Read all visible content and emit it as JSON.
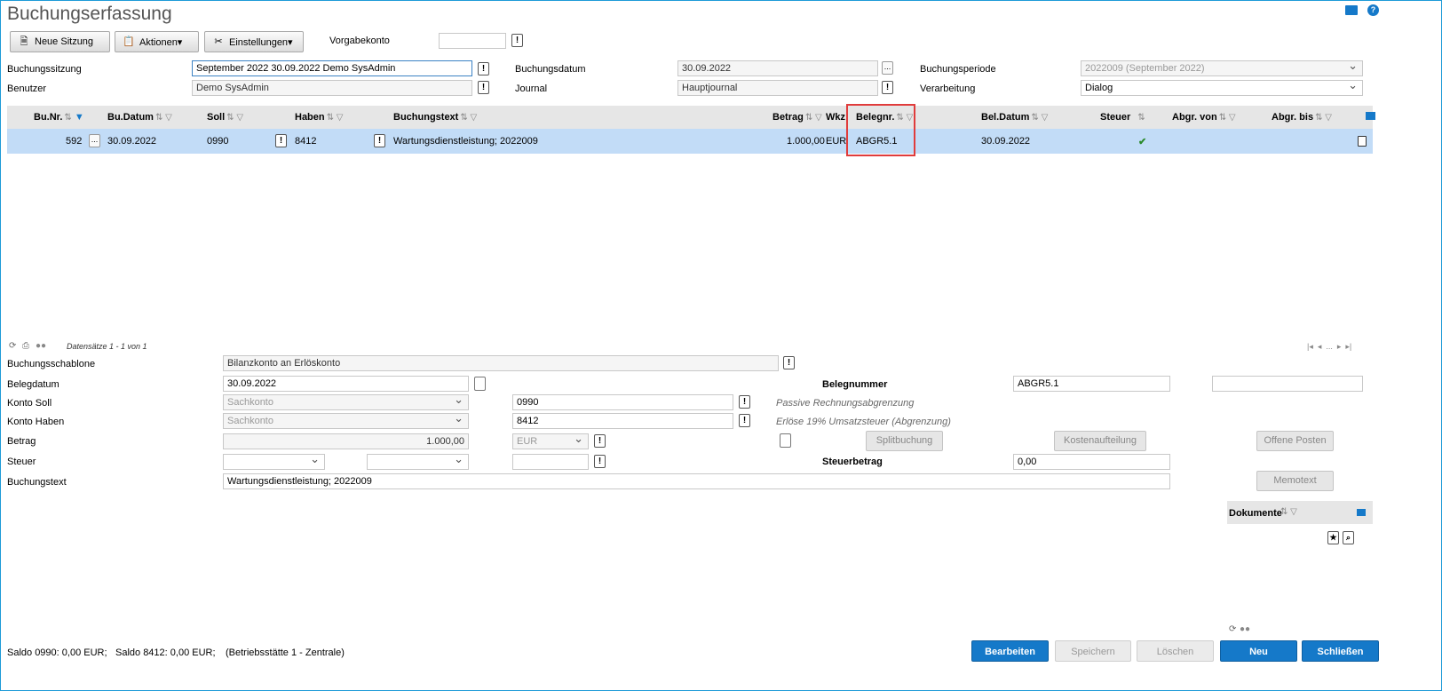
{
  "title": "Buchungserfassung",
  "toolbar": {
    "neue_sitzung": "Neue Sitzung",
    "aktionen": "Aktionen▾",
    "einstellungen": "Einstellungen▾",
    "vorgabekonto_label": "Vorgabekonto",
    "vorgabekonto_value": ""
  },
  "header_form": {
    "buchungssitzung_label": "Buchungssitzung",
    "buchungssitzung_value": "September 2022 30.09.2022 Demo SysAdmin",
    "benutzer_label": "Benutzer",
    "benutzer_value": "Demo SysAdmin",
    "buchungsdatum_label": "Buchungsdatum",
    "buchungsdatum_value": "30.09.2022",
    "journal_label": "Journal",
    "journal_value": "Hauptjournal",
    "buchungsperiode_label": "Buchungsperiode",
    "buchungsperiode_value": "2022009 (September 2022)",
    "verarbeitung_label": "Verarbeitung",
    "verarbeitung_value": "Dialog"
  },
  "grid": {
    "columns": [
      "Bu.Nr.",
      "Bu.Datum",
      "Soll",
      "Haben",
      "Buchungstext",
      "Betrag",
      "Wkz",
      "Belegnr.",
      "Bel.Datum",
      "Steuer",
      "Abgr. von",
      "Abgr. bis"
    ],
    "row": {
      "bunr": "592",
      "budatum": "30.09.2022",
      "soll": "0990",
      "haben": "8412",
      "buchungstext": "Wartungsdienstleistung; 2022009",
      "betrag": "1.000,00",
      "wkz": "EUR",
      "belegnr": "ABGR5.1",
      "beldatum": "30.09.2022",
      "steuer": "✔"
    },
    "records": "Datensätze 1 - 1 von 1",
    "pager": "|◂  ◂  ...  ▸  ▸|"
  },
  "detail": {
    "schablone_label": "Buchungsschablone",
    "schablone_value": "Bilanzkonto an Erlöskonto",
    "belegdatum_label": "Belegdatum",
    "belegdatum_value": "30.09.2022",
    "belegnummer_label": "Belegnummer",
    "belegnummer_value": "ABGR5.1",
    "konto_soll_label": "Konto Soll",
    "konto_soll_type": "Sachkonto",
    "konto_soll_value": "0990",
    "konto_soll_desc": "Passive Rechnungsabgrenzung",
    "konto_haben_label": "Konto Haben",
    "konto_haben_type": "Sachkonto",
    "konto_haben_value": "8412",
    "konto_haben_desc": "Erlöse 19% Umsatzsteuer (Abgrenzung)",
    "betrag_label": "Betrag",
    "betrag_value": "1.000,00",
    "waehrung_value": "EUR",
    "splitbuchung": "Splitbuchung",
    "kostenaufteilung": "Kostenaufteilung",
    "offene_posten": "Offene Posten",
    "steuer_label": "Steuer",
    "steuerbetrag_label": "Steuerbetrag",
    "steuerbetrag_value": "0,00",
    "buchungstext_label": "Buchungstext",
    "buchungstext_value": "Wartungsdienstleistung; 2022009",
    "memotext": "Memotext",
    "dokumente_label": "Dokumente"
  },
  "status": {
    "saldo_0990": "Saldo 0990: 0,00 EUR;",
    "saldo_8412": "Saldo 8412: 0,00 EUR;",
    "betriebsstaette": "(Betriebsstätte 1 - Zentrale)"
  },
  "footer_buttons": {
    "bearbeiten": "Bearbeiten",
    "speichern": "Speichern",
    "loeschen": "Löschen",
    "neu": "Neu",
    "schliessen": "Schließen"
  }
}
